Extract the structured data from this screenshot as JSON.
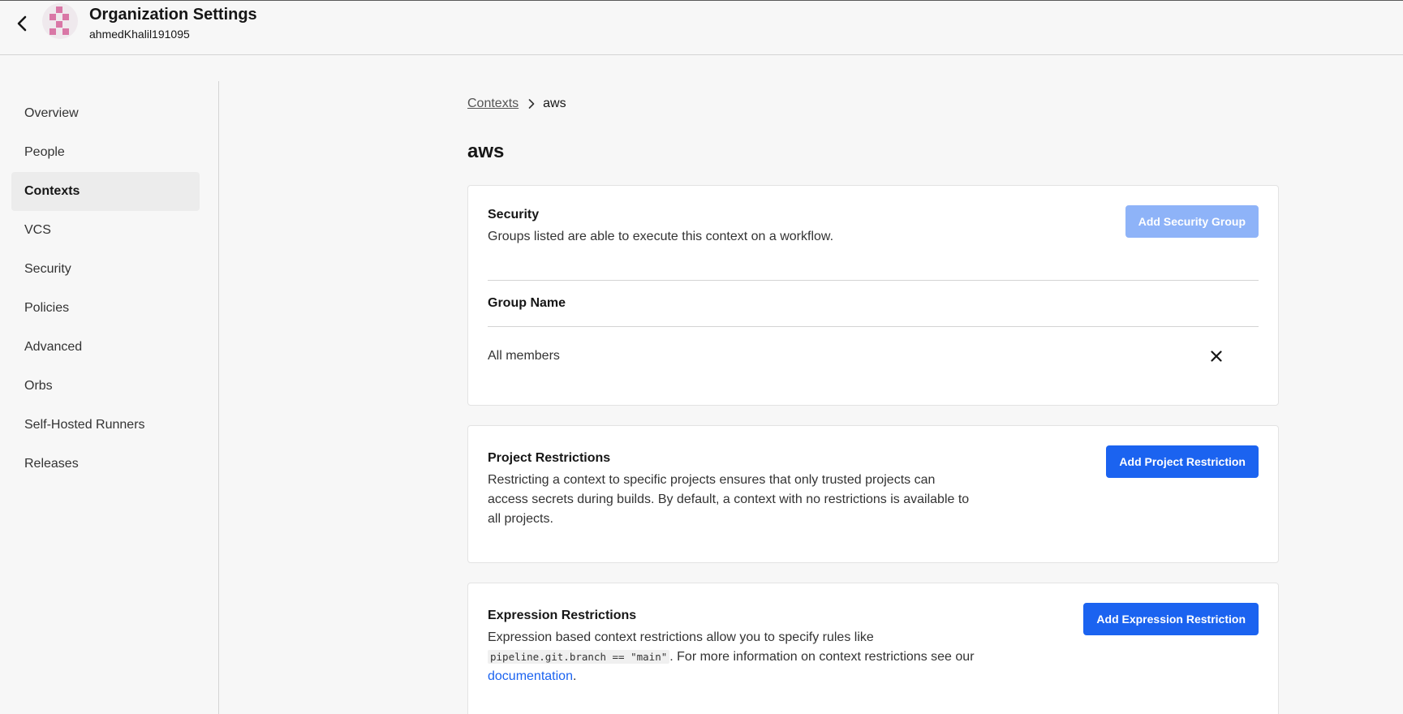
{
  "header": {
    "title": "Organization Settings",
    "subtitle": "ahmedKhalil191095",
    "back_icon": "chevron-left-icon",
    "avatar_color": "#d977a6"
  },
  "sidebar": {
    "items": [
      {
        "label": "Overview",
        "active": false
      },
      {
        "label": "People",
        "active": false
      },
      {
        "label": "Contexts",
        "active": true
      },
      {
        "label": "VCS",
        "active": false
      },
      {
        "label": "Security",
        "active": false
      },
      {
        "label": "Policies",
        "active": false
      },
      {
        "label": "Advanced",
        "active": false
      },
      {
        "label": "Orbs",
        "active": false
      },
      {
        "label": "Self-Hosted Runners",
        "active": false
      },
      {
        "label": "Releases",
        "active": false
      }
    ]
  },
  "breadcrumb": {
    "parent": "Contexts",
    "current": "aws",
    "separator_icon": "chevron-right-icon"
  },
  "page_title": "aws",
  "security": {
    "title": "Security",
    "description": "Groups listed are able to execute this context on a workflow.",
    "add_button": "Add Security Group",
    "column_header": "Group Name",
    "groups": [
      {
        "name": "All members",
        "remove_icon": "close-icon"
      }
    ]
  },
  "project_restrictions": {
    "title": "Project Restrictions",
    "description_lines": [
      "Restricting a context to specific projects ensures that only trusted projects can",
      "access secrets during builds. By default, a context with no restrictions is available to",
      "all projects."
    ],
    "add_button": "Add Project Restriction"
  },
  "expression_restrictions": {
    "title": "Expression Restrictions",
    "description_line1": "Expression based context restrictions allow you to specify rules like",
    "code_snippet": "pipeline.git.branch == \"main\"",
    "description_line2_after_code": ". For more information on context restrictions see our",
    "link_text": "documentation",
    "link_suffix": ".",
    "add_button": "Add Expression Restriction"
  },
  "colors": {
    "primary_button": "#1b63f0",
    "disabled_button": "#8eb3f8",
    "background": "#f7f7f7",
    "card": "#ffffff"
  }
}
